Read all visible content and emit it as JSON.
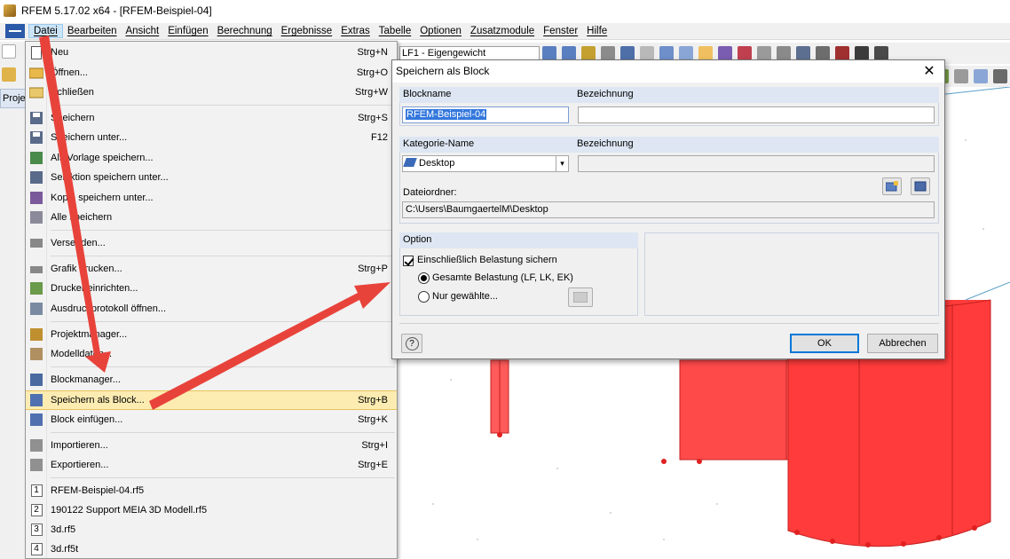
{
  "window": {
    "title": "RFEM 5.17.02 x64 - [RFEM-Beispiel-04]"
  },
  "menubar": {
    "items": [
      "Datei",
      "Bearbeiten",
      "Ansicht",
      "Einfügen",
      "Berechnung",
      "Ergebnisse",
      "Extras",
      "Tabelle",
      "Optionen",
      "Zusatzmodule",
      "Fenster",
      "Hilfe"
    ],
    "active": "Datei"
  },
  "toolbar": {
    "loadcase_combo": "LF1 - Eigengewicht"
  },
  "left_panel": {
    "tab_label": "Proje"
  },
  "file_menu": {
    "items": [
      {
        "label": "Neu",
        "shortcut": "Strg+N"
      },
      {
        "label": "Öffnen...",
        "shortcut": "Strg+O"
      },
      {
        "label": "Schließen",
        "shortcut": "Strg+W"
      },
      {
        "label": "Speichern",
        "shortcut": "Strg+S"
      },
      {
        "label": "Speichern unter...",
        "shortcut": "F12"
      },
      {
        "label": "Als Vorlage speichern...",
        "shortcut": ""
      },
      {
        "label": "Selektion speichern unter...",
        "shortcut": ""
      },
      {
        "label": "Kopie speichern unter...",
        "shortcut": ""
      },
      {
        "label": "Alle speichern",
        "shortcut": ""
      },
      {
        "label": "Versenden...",
        "shortcut": ""
      },
      {
        "label": "Grafik drucken...",
        "shortcut": "Strg+P"
      },
      {
        "label": "Drucker einrichten...",
        "shortcut": ""
      },
      {
        "label": "Ausdruckprotokoll öffnen...",
        "shortcut": ""
      },
      {
        "label": "Projektmanager...",
        "shortcut": ""
      },
      {
        "label": "Modelldaten...",
        "shortcut": ""
      },
      {
        "label": "Blockmanager...",
        "shortcut": ""
      },
      {
        "label": "Speichern als Block...",
        "shortcut": "Strg+B"
      },
      {
        "label": "Block einfügen...",
        "shortcut": "Strg+K"
      },
      {
        "label": "Importieren...",
        "shortcut": "Strg+I"
      },
      {
        "label": "Exportieren...",
        "shortcut": "Strg+E"
      },
      {
        "label": "RFEM-Beispiel-04.rf5",
        "shortcut": "",
        "num": "1"
      },
      {
        "label": "190122 Support MEIA 3D Modell.rf5",
        "shortcut": "",
        "num": "2"
      },
      {
        "label": "3d.rf5",
        "shortcut": "",
        "num": "3"
      },
      {
        "label": "3d.rf5t",
        "shortcut": "",
        "num": "4"
      }
    ],
    "highlighted": "Speichern als Block..."
  },
  "dialog": {
    "title": "Speichern als Block",
    "close": "✕",
    "blockname_header": "Blockname",
    "bezeichnung_header": "Bezeichnung",
    "blockname_value": "RFEM-Beispiel-04",
    "kategorie_header": "Kategorie-Name",
    "bezeichnung2_header": "Bezeichnung",
    "kategorie_value": "Desktop",
    "dateiordner_label": "Dateiordner:",
    "dateiordner_value": "C:\\Users\\BaumgaertelM\\Desktop",
    "option_header": "Option",
    "checkbox_label": "Einschließlich Belastung sichern",
    "radio1_label": "Gesamte Belastung (LF, LK, EK)",
    "radio2_label": "Nur gewählte...",
    "ok": "OK",
    "cancel": "Abbrechen",
    "help": "?"
  },
  "colors": {
    "arrow": "#e8433b",
    "structure": "#ff3b3b",
    "highlight": "#fcecb2"
  }
}
